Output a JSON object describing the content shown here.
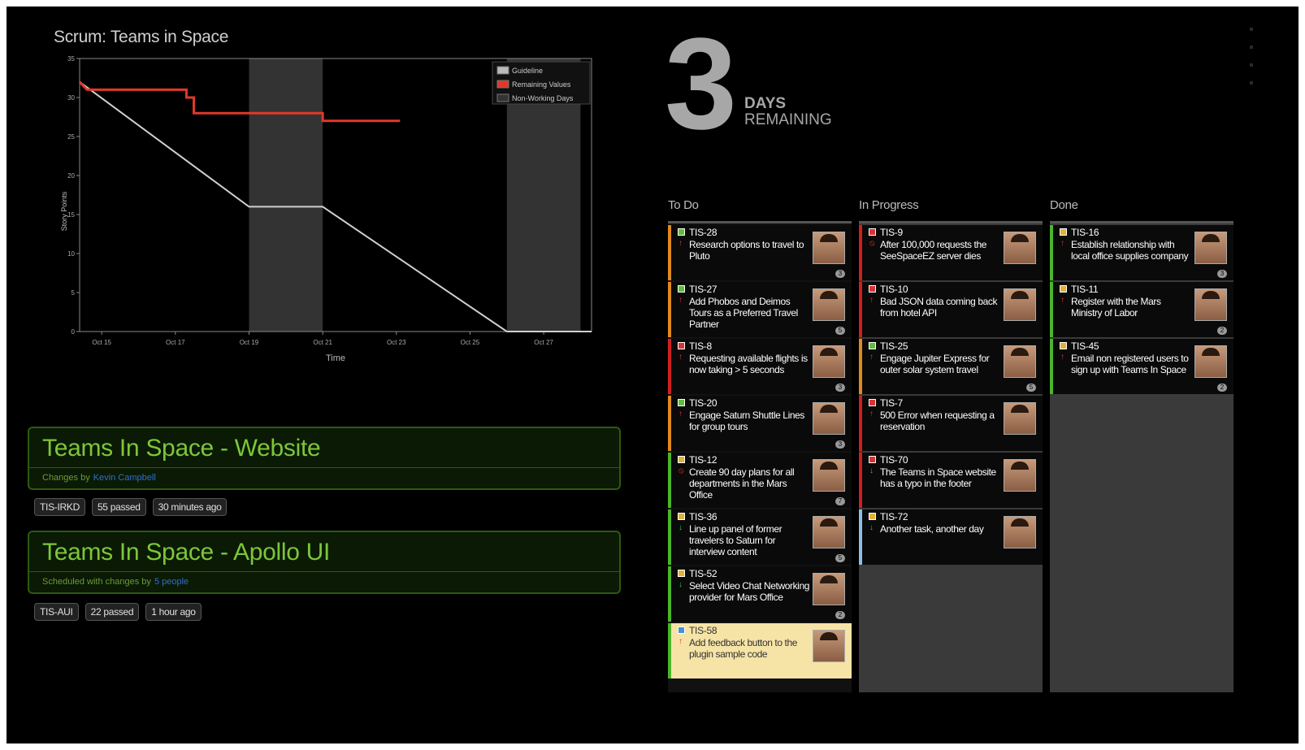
{
  "chart_data": {
    "type": "line",
    "title": "Scrum: Teams in Space",
    "xlabel": "Time",
    "ylabel": "Story Points",
    "ylim": [
      0,
      35
    ],
    "yticks": [
      0,
      5,
      10,
      15,
      20,
      25,
      30,
      35
    ],
    "xticks": [
      "Oct 15",
      "Oct 17",
      "Oct 19",
      "Oct 21",
      "Oct 23",
      "Oct 25",
      "Oct 27"
    ],
    "xlim": [
      14.4,
      28.3
    ],
    "grid": false,
    "legend_position": "top-right",
    "legend": [
      "Guideline",
      "Remaining Values",
      "Non-Working Days"
    ],
    "non_working_days": [
      [
        19,
        21
      ],
      [
        26,
        28
      ]
    ],
    "series": [
      {
        "name": "Guideline",
        "color": "#d0d0d0",
        "x": [
          14.4,
          19,
          21,
          26,
          28.3
        ],
        "y": [
          32,
          16,
          16,
          0,
          0
        ]
      },
      {
        "name": "Remaining Values",
        "color": "#e0382b",
        "x": [
          14.4,
          14.6,
          17.3,
          17.3,
          17.5,
          17.5,
          21,
          21,
          23.1
        ],
        "y": [
          32,
          31,
          31,
          30,
          30,
          28,
          28,
          27,
          27
        ]
      }
    ]
  },
  "days": {
    "number": "3",
    "line1": "DAYS",
    "line2": "REMAINING"
  },
  "builds": [
    {
      "title": "Teams In Space - Website",
      "sub": "Changes by",
      "who": "Kevin Campbell",
      "tags": [
        "TIS-IRKD",
        "55 passed",
        "30 minutes ago"
      ]
    },
    {
      "title": "Teams In Space - Apollo UI",
      "sub": "Scheduled with changes by",
      "who": "5 people",
      "tags": [
        "TIS-AUI",
        "22 passed",
        "1 hour ago"
      ]
    }
  ],
  "board": {
    "columns": [
      {
        "name": "To Do",
        "cards": [
          {
            "key": "TIS-28",
            "summary": "Research options to travel to Pluto",
            "type": "story",
            "priority": "up",
            "border": "orange",
            "est": "3"
          },
          {
            "key": "TIS-27",
            "summary": "Add Phobos and Deimos Tours as a Preferred Travel Partner",
            "type": "story",
            "priority": "up",
            "border": "orange",
            "est": "5"
          },
          {
            "key": "TIS-8",
            "summary": "Requesting available flights is now taking > 5 seconds",
            "type": "bug",
            "priority": "up",
            "border": "red",
            "est": "3"
          },
          {
            "key": "TIS-20",
            "summary": "Engage Saturn Shuttle Lines for group tours",
            "type": "story",
            "priority": "up",
            "border": "orange",
            "est": "3"
          },
          {
            "key": "TIS-12",
            "summary": "Create 90 day plans for all departments in the Mars Office",
            "type": "task",
            "priority": "block",
            "border": "green",
            "est": "7"
          },
          {
            "key": "TIS-36",
            "summary": "Line up panel of former travelers to Saturn for interview content",
            "type": "task",
            "priority": "down",
            "border": "green",
            "est": "5"
          },
          {
            "key": "TIS-52",
            "summary": "Select Video Chat Networking provider for Mars Office",
            "type": "task",
            "priority": "down",
            "border": "green",
            "est": "2"
          },
          {
            "key": "TIS-58",
            "summary": "Add feedback button to the plugin sample code",
            "type": "impr",
            "priority": "up",
            "border": "green",
            "est": "",
            "highlight": true
          }
        ]
      },
      {
        "name": "In Progress",
        "cards": [
          {
            "key": "TIS-9",
            "summary": "After 100,000 requests the SeeSpaceEZ server dies",
            "type": "bug",
            "priority": "block",
            "border": "red",
            "est": ""
          },
          {
            "key": "TIS-10",
            "summary": "Bad JSON data coming back from hotel API",
            "type": "bug",
            "priority": "up",
            "border": "red",
            "est": ""
          },
          {
            "key": "TIS-25",
            "summary": "Engage Jupiter Express for outer solar system travel",
            "type": "story",
            "priority": "up",
            "border": "orange",
            "est": "5"
          },
          {
            "key": "TIS-7",
            "summary": "500 Error when requesting a reservation",
            "type": "bug",
            "priority": "up",
            "border": "red",
            "est": ""
          },
          {
            "key": "TIS-70",
            "summary": "The Teams in Space website has a typo in the footer",
            "type": "bug",
            "priority": "down",
            "border": "red",
            "est": ""
          },
          {
            "key": "TIS-72",
            "summary": "Another task, another day",
            "type": "task",
            "priority": "down",
            "border": "blue",
            "est": ""
          }
        ]
      },
      {
        "name": "Done",
        "cards": [
          {
            "key": "TIS-16",
            "summary": "Establish relationship with local office supplies company",
            "type": "task",
            "priority": "up",
            "border": "green",
            "est": "3"
          },
          {
            "key": "TIS-11",
            "summary": "Register with the Mars Ministry of Labor",
            "type": "task",
            "priority": "up",
            "border": "green",
            "est": "2"
          },
          {
            "key": "TIS-45",
            "summary": "Email non registered users to sign up with Teams In Space",
            "type": "task",
            "priority": "up",
            "border": "green",
            "est": "2"
          }
        ]
      }
    ]
  }
}
